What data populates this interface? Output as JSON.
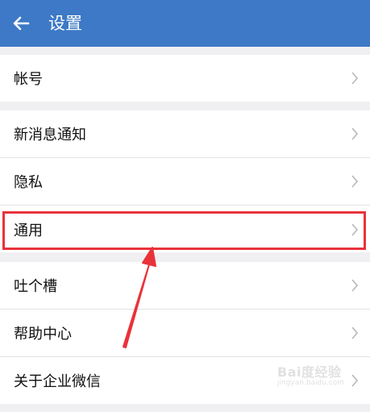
{
  "appbar": {
    "title": "设置",
    "back_icon": "arrow-left-icon"
  },
  "sections": [
    {
      "items": [
        {
          "label": "帐号"
        }
      ]
    },
    {
      "items": [
        {
          "label": "新消息通知"
        },
        {
          "label": "隐私"
        },
        {
          "label": "通用"
        }
      ]
    },
    {
      "items": [
        {
          "label": "吐个槽"
        },
        {
          "label": "帮助中心"
        },
        {
          "label": "关于企业微信"
        }
      ]
    }
  ],
  "annotation": {
    "highlight_color": "#e8333a",
    "highlighted_item": "通用"
  },
  "watermark": {
    "line1": "Bai度经验",
    "line2": "jingyan.baidu.com"
  },
  "colors": {
    "appbar": "#3d79c6",
    "background": "#f0f0f2"
  }
}
